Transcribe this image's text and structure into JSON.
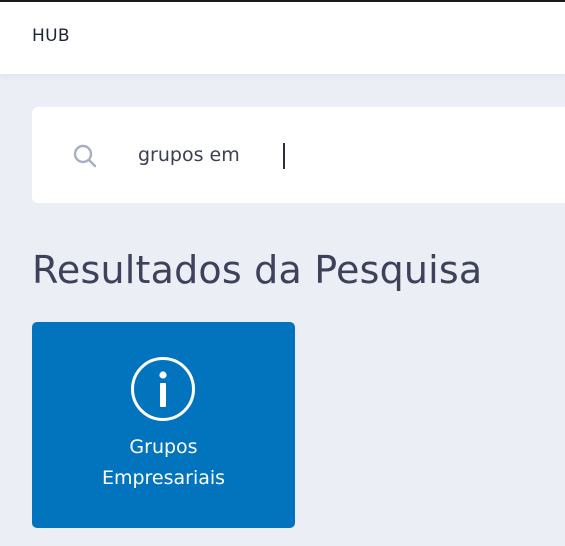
{
  "header": {
    "title": "HUB"
  },
  "search": {
    "icon": "search-icon",
    "value": "grupos em"
  },
  "results": {
    "title": "Resultados da Pesquisa",
    "items": [
      {
        "icon": "info-icon",
        "label_line1": "Grupos",
        "label_line2": "Empresariais",
        "color": "#0274BE"
      }
    ]
  },
  "colors": {
    "background": "#ECEEF6",
    "tile": "#0274BE",
    "text_dark": "#3d4159"
  }
}
